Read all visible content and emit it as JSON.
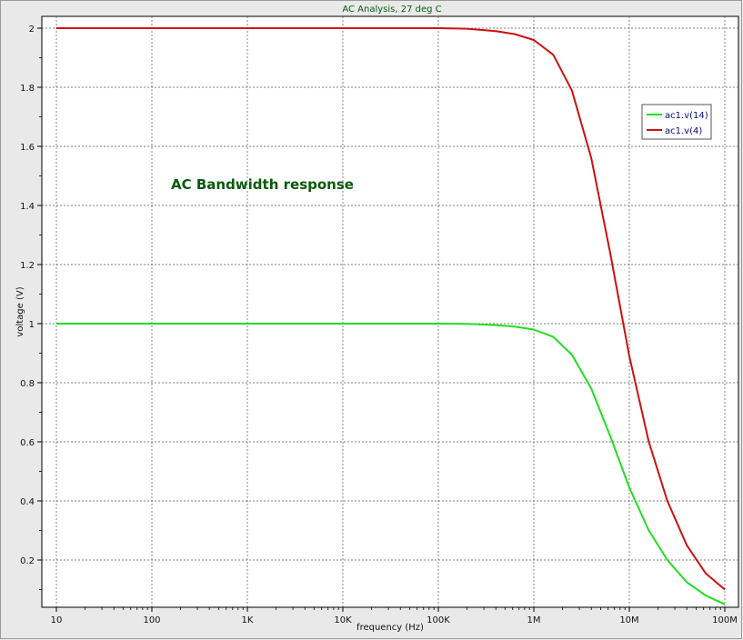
{
  "chart_data": {
    "type": "line",
    "title": "AC Analysis, 27 deg C",
    "xlabel": "frequency (Hz)",
    "ylabel": "voltage (V)",
    "x_scale": "log",
    "xlim": [
      10,
      100000000
    ],
    "ylim": [
      0.04,
      2.04
    ],
    "x_ticks": [
      {
        "value": 10,
        "label": "10"
      },
      {
        "value": 100,
        "label": "100"
      },
      {
        "value": 1000,
        "label": "1K"
      },
      {
        "value": 10000,
        "label": "10K"
      },
      {
        "value": 100000,
        "label": "100K"
      },
      {
        "value": 1000000,
        "label": "1M"
      },
      {
        "value": 10000000,
        "label": "10M"
      },
      {
        "value": 100000000,
        "label": "100M"
      }
    ],
    "y_ticks": [
      {
        "value": 0.2,
        "label": "0.2"
      },
      {
        "value": 0.4,
        "label": "0.4"
      },
      {
        "value": 0.6,
        "label": "0.6"
      },
      {
        "value": 0.8,
        "label": "0.8"
      },
      {
        "value": 1.0,
        "label": "1"
      },
      {
        "value": 1.2,
        "label": "1.2"
      },
      {
        "value": 1.4,
        "label": "1.4"
      },
      {
        "value": 1.6,
        "label": "1.6"
      },
      {
        "value": 1.8,
        "label": "1.8"
      },
      {
        "value": 2.0,
        "label": "2"
      }
    ],
    "grid": true,
    "legend_position": "top-right",
    "annotation": {
      "text": "AC Bandwidth response",
      "color": "#0a5a0a"
    },
    "title_color": "#0a5a0a",
    "background": "#ffffff",
    "series": [
      {
        "name": "ac1.v(14)",
        "color": "#22dd22",
        "label_color": "#0a0a80",
        "x": [
          10,
          100,
          1000,
          10000,
          100000,
          200000,
          400000,
          630000,
          1000000,
          1600000,
          2500000,
          4000000,
          6300000,
          10000000,
          16000000,
          25000000,
          40000000,
          63000000,
          100000000
        ],
        "y": [
          1.0,
          1.0,
          1.0,
          1.0,
          1.0,
          0.999,
          0.995,
          0.99,
          0.98,
          0.955,
          0.895,
          0.78,
          0.62,
          0.445,
          0.3,
          0.2,
          0.125,
          0.08,
          0.05
        ]
      },
      {
        "name": "ac1.v(4)",
        "color": "#cc1111",
        "label_color": "#0a0a80",
        "x": [
          10,
          100,
          1000,
          10000,
          100000,
          200000,
          400000,
          630000,
          1000000,
          1600000,
          2500000,
          4000000,
          6300000,
          10000000,
          16000000,
          25000000,
          40000000,
          63000000,
          100000000
        ],
        "y": [
          2.0,
          2.0,
          2.0,
          2.0,
          2.0,
          1.998,
          1.99,
          1.98,
          1.96,
          1.91,
          1.79,
          1.56,
          1.24,
          0.89,
          0.6,
          0.4,
          0.25,
          0.155,
          0.1
        ]
      }
    ]
  }
}
